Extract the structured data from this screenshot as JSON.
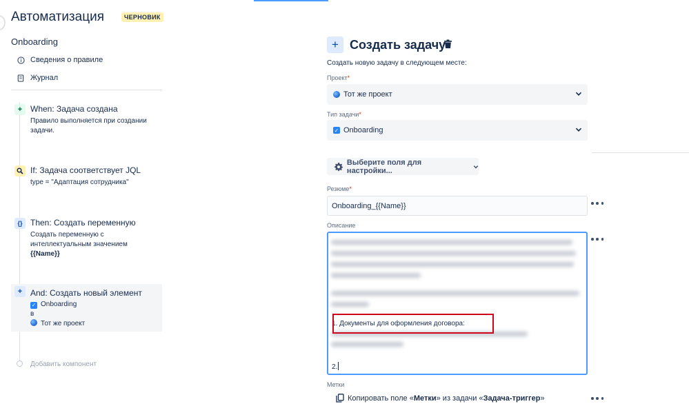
{
  "header": {
    "title": "Автоматизация",
    "badge": "ЧЕРНОВИК"
  },
  "sidebar": {
    "rule_name": "Onboarding",
    "nav": [
      {
        "label": "Сведения о правиле",
        "icon": "info-icon"
      },
      {
        "label": "Журнал",
        "icon": "journal-icon"
      }
    ],
    "steps": [
      {
        "icon": "+",
        "title": "When: Задача создана",
        "desc": "Правило выполняется при создании задачи."
      },
      {
        "icon": "search",
        "title": "If: Задача соответствует JQL",
        "desc": "type = \"Адаптация сотрудника\""
      },
      {
        "icon": "{}",
        "title": "Then: Создать переменную",
        "desc_prefix": "Создать переменную с интеллектуальным значением",
        "desc_value": "{{Name}}"
      },
      {
        "icon": "+",
        "title": "And: Создать новый элемент",
        "issue_type": "Onboarding",
        "in": "в",
        "project": "Тот же проект"
      }
    ],
    "add_component": "Добавить компонент"
  },
  "action": {
    "title": "Создать задачу",
    "subtitle": "Создать новую задачу в следующем месте:",
    "project_label": "Проект",
    "project_value": "Тот же проект",
    "issue_type_label": "Тип задачи",
    "issue_type_value": "Onboarding",
    "fields_button": "Выберите поля для настройки...",
    "summary_label": "Резюме",
    "summary_value": "Onboarding_{{Name}}",
    "description_label": "Описание",
    "description_line1": "1. Документы для оформления договора:",
    "description_line2": "2.",
    "labels_label": "Метки",
    "labels_copy_prefix": "Копировать поле «",
    "labels_field": "Метки",
    "labels_copy_mid": "» из задачи «",
    "labels_source": "Задача-триггер",
    "labels_copy_suffix": "»"
  },
  "colors": {
    "accent": "#2684ff",
    "focus_border": "#4c9aff",
    "highlight_box": "#d0021b",
    "badge_bg": "#fff0b3",
    "required": "#de350b"
  }
}
